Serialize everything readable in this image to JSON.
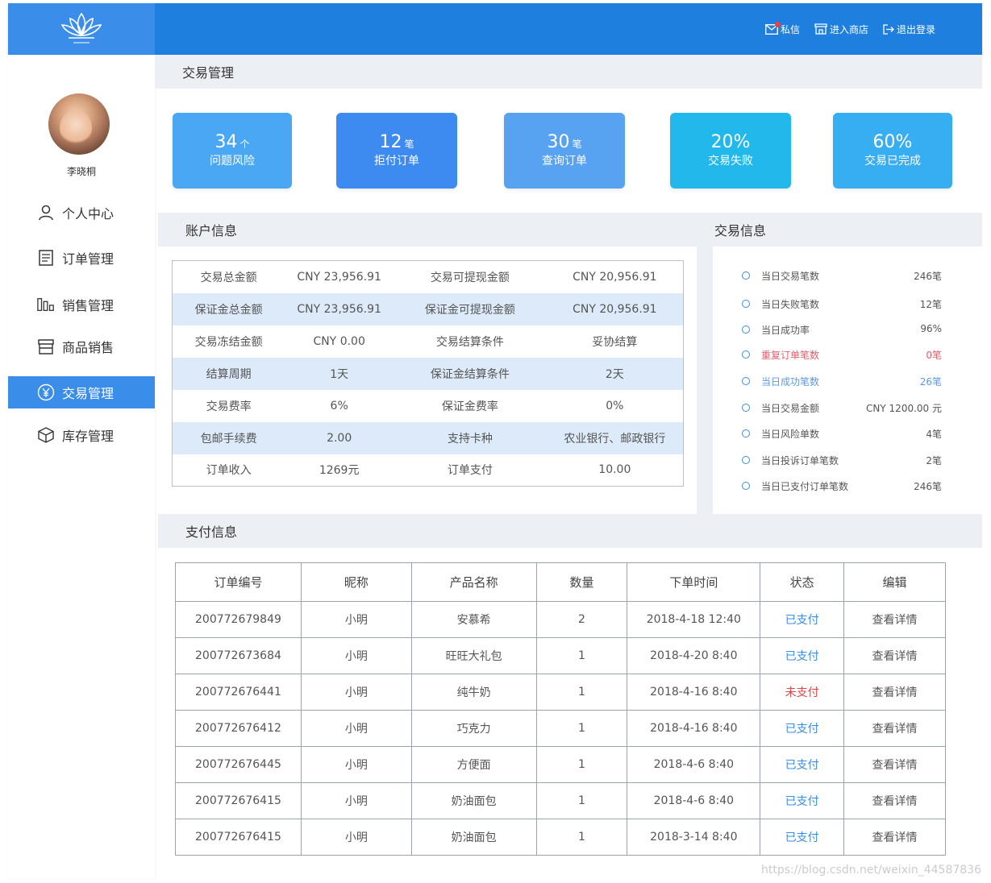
{
  "header": {
    "actions": [
      {
        "label": "私信",
        "icon": "mail-icon"
      },
      {
        "label": "进入商店",
        "icon": "store-icon"
      },
      {
        "label": "退出登录",
        "icon": "logout-icon"
      }
    ]
  },
  "sidebar": {
    "username": "李晓桐",
    "items": [
      {
        "label": "个人中心",
        "icon": "user-icon"
      },
      {
        "label": "订单管理",
        "icon": "document-icon"
      },
      {
        "label": "销售管理",
        "icon": "bar-chart-icon"
      },
      {
        "label": "商品销售",
        "icon": "shop-icon"
      },
      {
        "label": "交易管理",
        "icon": "yen-icon",
        "active": true
      },
      {
        "label": "库存管理",
        "icon": "box-icon"
      }
    ]
  },
  "main": {
    "title": "交易管理",
    "stats": [
      {
        "num": "34",
        "unit": "个",
        "label": "问题风险",
        "color": "#4aa7f3"
      },
      {
        "num": "12",
        "unit": "笔",
        "label": "拒付订单",
        "color": "#3d8bf0"
      },
      {
        "num": "30",
        "unit": "笔",
        "label": "查询订单",
        "color": "#58a2f2"
      },
      {
        "num": "20%",
        "unit": "",
        "label": "交易失败",
        "color": "#22b8ec"
      },
      {
        "num": "60%",
        "unit": "",
        "label": "交易已完成",
        "color": "#38aef2"
      }
    ],
    "account": {
      "title": "账户信息",
      "rows": [
        [
          "交易总金额",
          "CNY 23,956.91",
          "交易可提现金额",
          "CNY 20,956.91"
        ],
        [
          "保证金总金额",
          "CNY 23,956.91",
          "保证金可提现金额",
          "CNY 20,956.91"
        ],
        [
          "交易冻结金额",
          "CNY 0.00",
          "交易结算条件",
          "妥协结算"
        ],
        [
          "结算周期",
          "1天",
          "保证金结算条件",
          "2天"
        ],
        [
          "交易费率",
          "6%",
          "保证金费率",
          "0%"
        ],
        [
          "包邮手续费",
          "2.00",
          "支持卡种",
          "农业银行、邮政银行"
        ],
        [
          "订单收入",
          "1269元",
          "订单支付",
          "10.00"
        ]
      ]
    },
    "trade": {
      "title": "交易信息",
      "rows": [
        {
          "label": "当日交易笔数",
          "value": "246笔",
          "style": ""
        },
        {
          "label": "当日失败笔数",
          "value": "12笔",
          "style": ""
        },
        {
          "label": "当日成功率",
          "value": "96%",
          "style": ""
        },
        {
          "label": "重复订单笔数",
          "value": "0笔",
          "style": "red"
        },
        {
          "label": "当日成功笔数",
          "value": "26笔",
          "style": "blue"
        },
        {
          "label": "当日交易金额",
          "value": "CNY 1200.00 元",
          "style": ""
        },
        {
          "label": "当日风险单数",
          "value": "4笔",
          "style": ""
        },
        {
          "label": "当日投诉订单笔数",
          "value": "2笔",
          "style": ""
        },
        {
          "label": "当日已支付订单笔数",
          "value": "246笔",
          "style": ""
        }
      ]
    },
    "payment": {
      "title": "支付信息",
      "columns": [
        "订单编号",
        "昵称",
        "产品名称",
        "数量",
        "下单时间",
        "状态",
        "编辑"
      ],
      "rows": [
        {
          "id": "200772679849",
          "nick": "小明",
          "product": "安慕希",
          "qty": "2",
          "time": "2018-4-18 12:40",
          "status": "已支付",
          "paid": true,
          "action": "查看详情"
        },
        {
          "id": "200772673684",
          "nick": "小明",
          "product": "旺旺大礼包",
          "qty": "1",
          "time": "2018-4-20 8:40",
          "status": "已支付",
          "paid": true,
          "action": "查看详情"
        },
        {
          "id": "200772676441",
          "nick": "小明",
          "product": "纯牛奶",
          "qty": "1",
          "time": "2018-4-16 8:40",
          "status": "未支付",
          "paid": false,
          "action": "查看详情"
        },
        {
          "id": "200772676412",
          "nick": "小明",
          "product": "巧克力",
          "qty": "1",
          "time": "2018-4-16 8:40",
          "status": "已支付",
          "paid": true,
          "action": "查看详情"
        },
        {
          "id": "200772676445",
          "nick": "小明",
          "product": "方便面",
          "qty": "1",
          "time": "2018-4-6 8:40",
          "status": "已支付",
          "paid": true,
          "action": "查看详情"
        },
        {
          "id": "200772676415",
          "nick": "小明",
          "product": "奶油面包",
          "qty": "1",
          "time": "2018-4-6 8:40",
          "status": "已支付",
          "paid": true,
          "action": "查看详情"
        },
        {
          "id": "200772676415",
          "nick": "小明",
          "product": "奶油面包",
          "qty": "1",
          "time": "2018-3-14 8:40",
          "status": "已支付",
          "paid": true,
          "action": "查看详情"
        }
      ]
    }
  },
  "watermark": "https://blog.csdn.net/weixin_44587836"
}
